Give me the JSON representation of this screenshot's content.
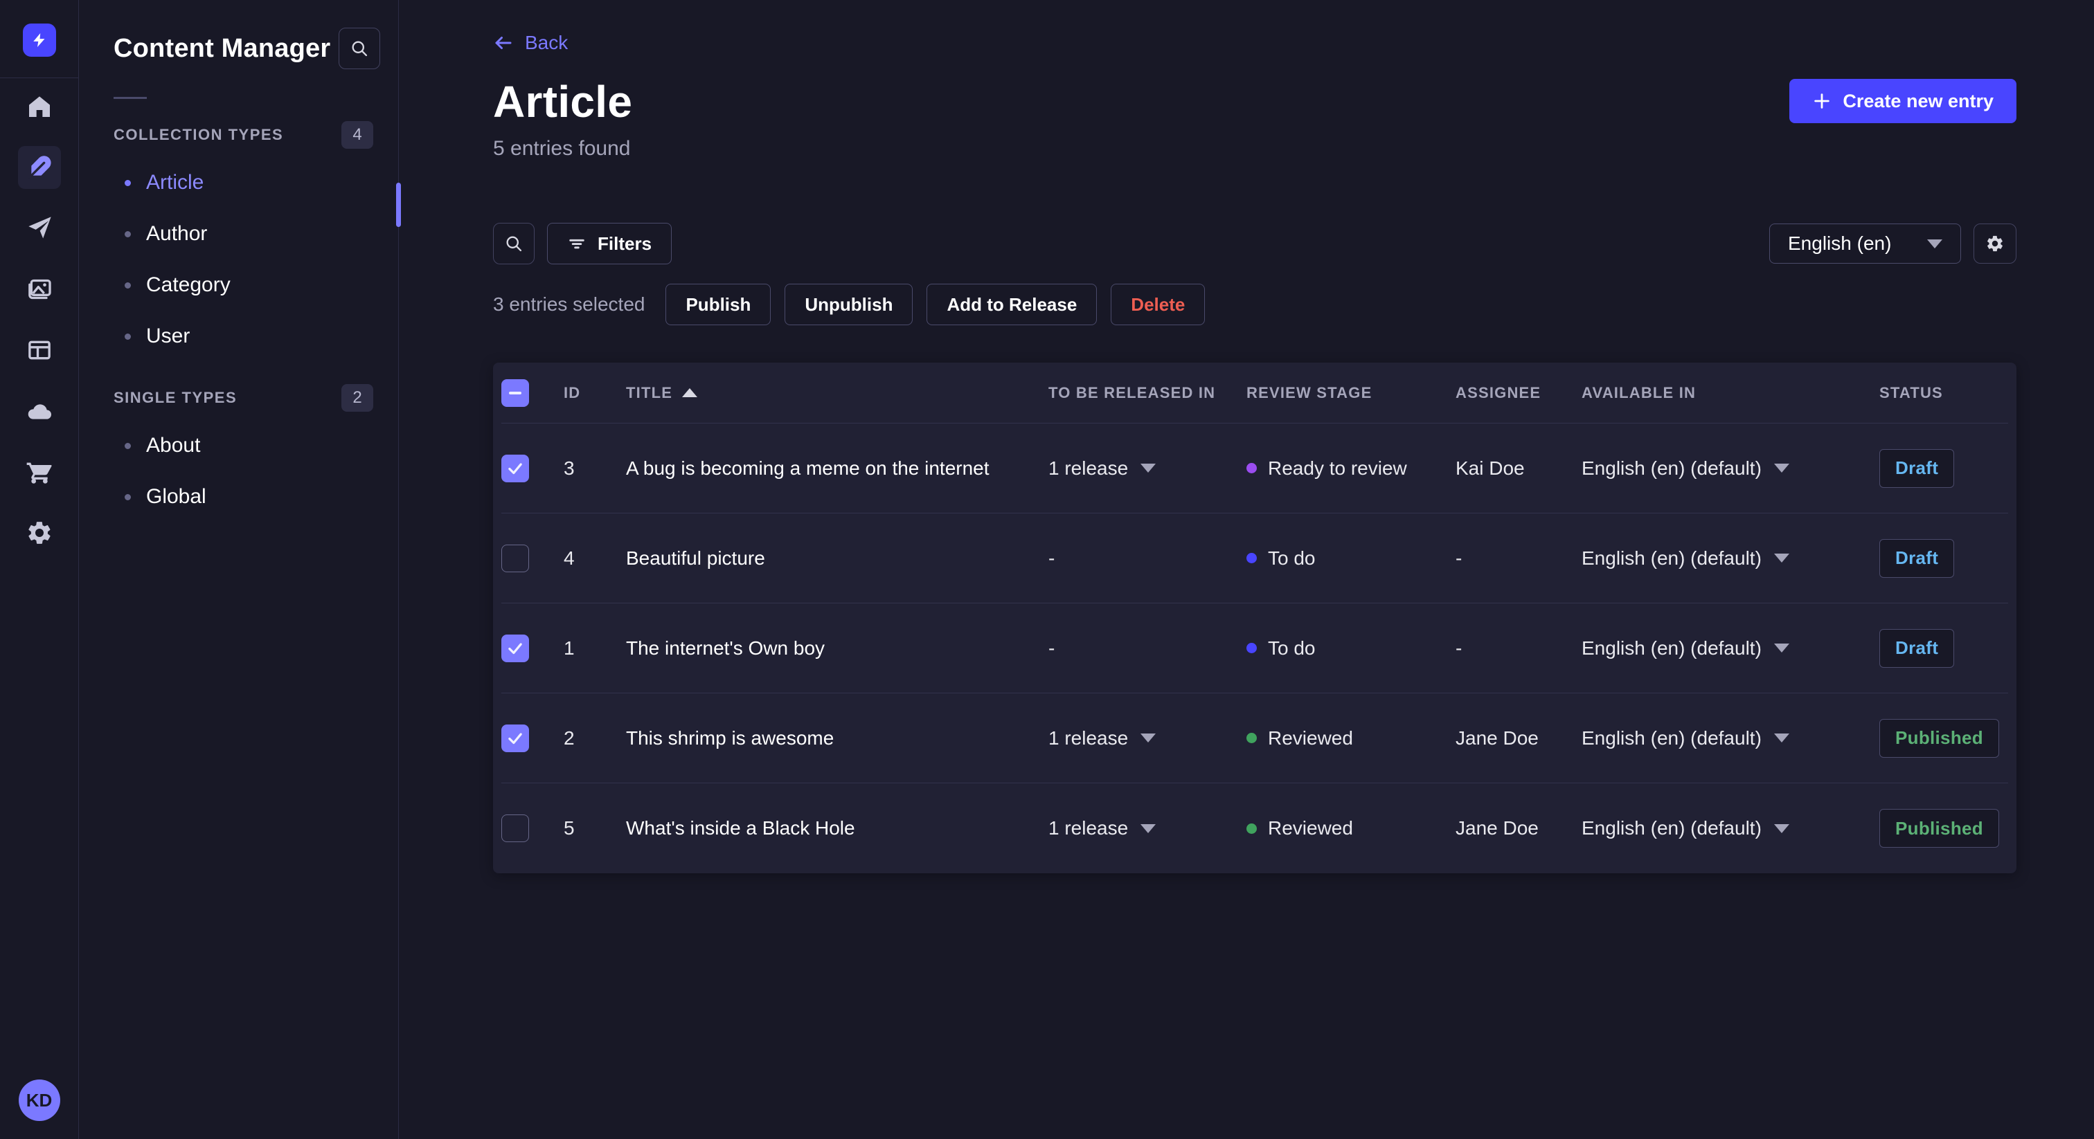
{
  "rail": {
    "logo": "strapi-logo",
    "items": [
      {
        "name": "home",
        "active": false
      },
      {
        "name": "content-manager",
        "active": true
      },
      {
        "name": "releases",
        "active": false
      },
      {
        "name": "media-library",
        "active": false
      },
      {
        "name": "content-type-builder",
        "active": false
      },
      {
        "name": "deploy",
        "active": false
      },
      {
        "name": "marketplace",
        "active": false
      },
      {
        "name": "settings",
        "active": false
      }
    ],
    "avatar_initials": "KD"
  },
  "subnav": {
    "title": "Content Manager",
    "sections": [
      {
        "label": "COLLECTION TYPES",
        "badge": "4",
        "items": [
          {
            "label": "Article",
            "active": true
          },
          {
            "label": "Author",
            "active": false
          },
          {
            "label": "Category",
            "active": false
          },
          {
            "label": "User",
            "active": false
          }
        ]
      },
      {
        "label": "SINGLE TYPES",
        "badge": "2",
        "items": [
          {
            "label": "About",
            "active": false
          },
          {
            "label": "Global",
            "active": false
          }
        ]
      }
    ]
  },
  "header": {
    "back_label": "Back",
    "title": "Article",
    "subtitle": "5 entries found",
    "create_button": "Create new entry"
  },
  "toolbar": {
    "filters_label": "Filters",
    "locale_selected": "English (en)"
  },
  "selection": {
    "text": "3 entries selected",
    "publish": "Publish",
    "unpublish": "Unpublish",
    "add_to_release": "Add to Release",
    "delete": "Delete"
  },
  "table": {
    "columns": [
      "ID",
      "TITLE",
      "TO BE RELEASED IN",
      "REVIEW STAGE",
      "ASSIGNEE",
      "AVAILABLE IN",
      "STATUS"
    ],
    "sort": {
      "column": "TITLE",
      "direction": "asc"
    },
    "rows": [
      {
        "checked": true,
        "id": "3",
        "title": "A bug is becoming a meme on the internet",
        "release": "1 release",
        "stage": "Ready to review",
        "stage_color": "#9b4df0",
        "assignee": "Kai Doe",
        "locale": "English (en) (default)",
        "status": "Draft",
        "status_variant": "draft"
      },
      {
        "checked": false,
        "id": "4",
        "title": "Beautiful picture",
        "release": "-",
        "stage": "To do",
        "stage_color": "#4945ff",
        "assignee": "-",
        "locale": "English (en) (default)",
        "status": "Draft",
        "status_variant": "draft"
      },
      {
        "checked": true,
        "id": "1",
        "title": "The internet's Own boy",
        "release": "-",
        "stage": "To do",
        "stage_color": "#4945ff",
        "assignee": "-",
        "locale": "English (en) (default)",
        "status": "Draft",
        "status_variant": "draft"
      },
      {
        "checked": true,
        "id": "2",
        "title": "This shrimp is awesome",
        "release": "1 release",
        "stage": "Reviewed",
        "stage_color": "#40a35e",
        "assignee": "Jane Doe",
        "locale": "English (en) (default)",
        "status": "Published",
        "status_variant": "published"
      },
      {
        "checked": false,
        "id": "5",
        "title": "What's inside a Black Hole",
        "release": "1 release",
        "stage": "Reviewed",
        "stage_color": "#40a35e",
        "assignee": "Jane Doe",
        "locale": "English (en) (default)",
        "status": "Published",
        "status_variant": "published"
      }
    ]
  },
  "help": {
    "label": "?"
  },
  "colors": {
    "background": "#181826",
    "panel": "#212134",
    "primary": "#4945ff",
    "primary_light": "#7b79ff",
    "draft": "#66b7f1",
    "published": "#5cb176",
    "danger": "#ee5e52"
  }
}
